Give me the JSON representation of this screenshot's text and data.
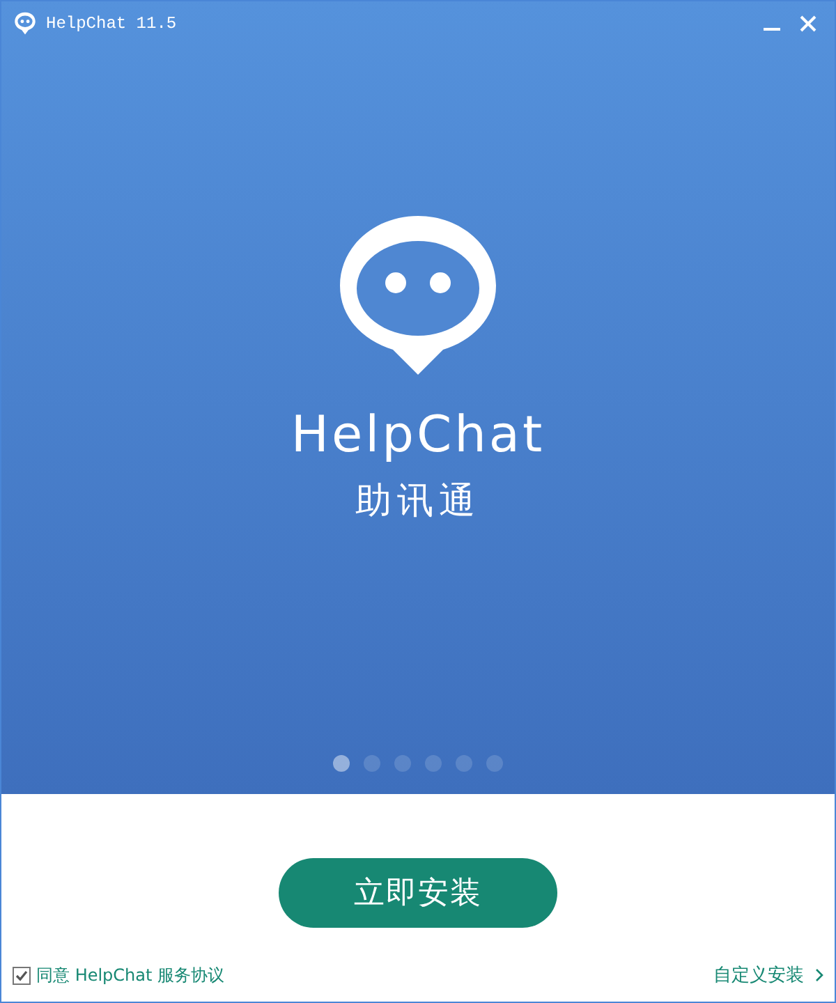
{
  "window": {
    "title": "HelpChat 11.5"
  },
  "hero": {
    "app_name": "HelpChat",
    "subtitle": "助讯通"
  },
  "carousel_dots": [
    {
      "selected": true
    },
    {
      "selected": false
    },
    {
      "selected": false
    },
    {
      "selected": false
    },
    {
      "selected": false
    },
    {
      "selected": false
    }
  ],
  "install_button": "立即安装",
  "agreement": {
    "label": "同意 HelpChat 服务协议",
    "checked": true
  },
  "custom_install": "自定义安装"
}
